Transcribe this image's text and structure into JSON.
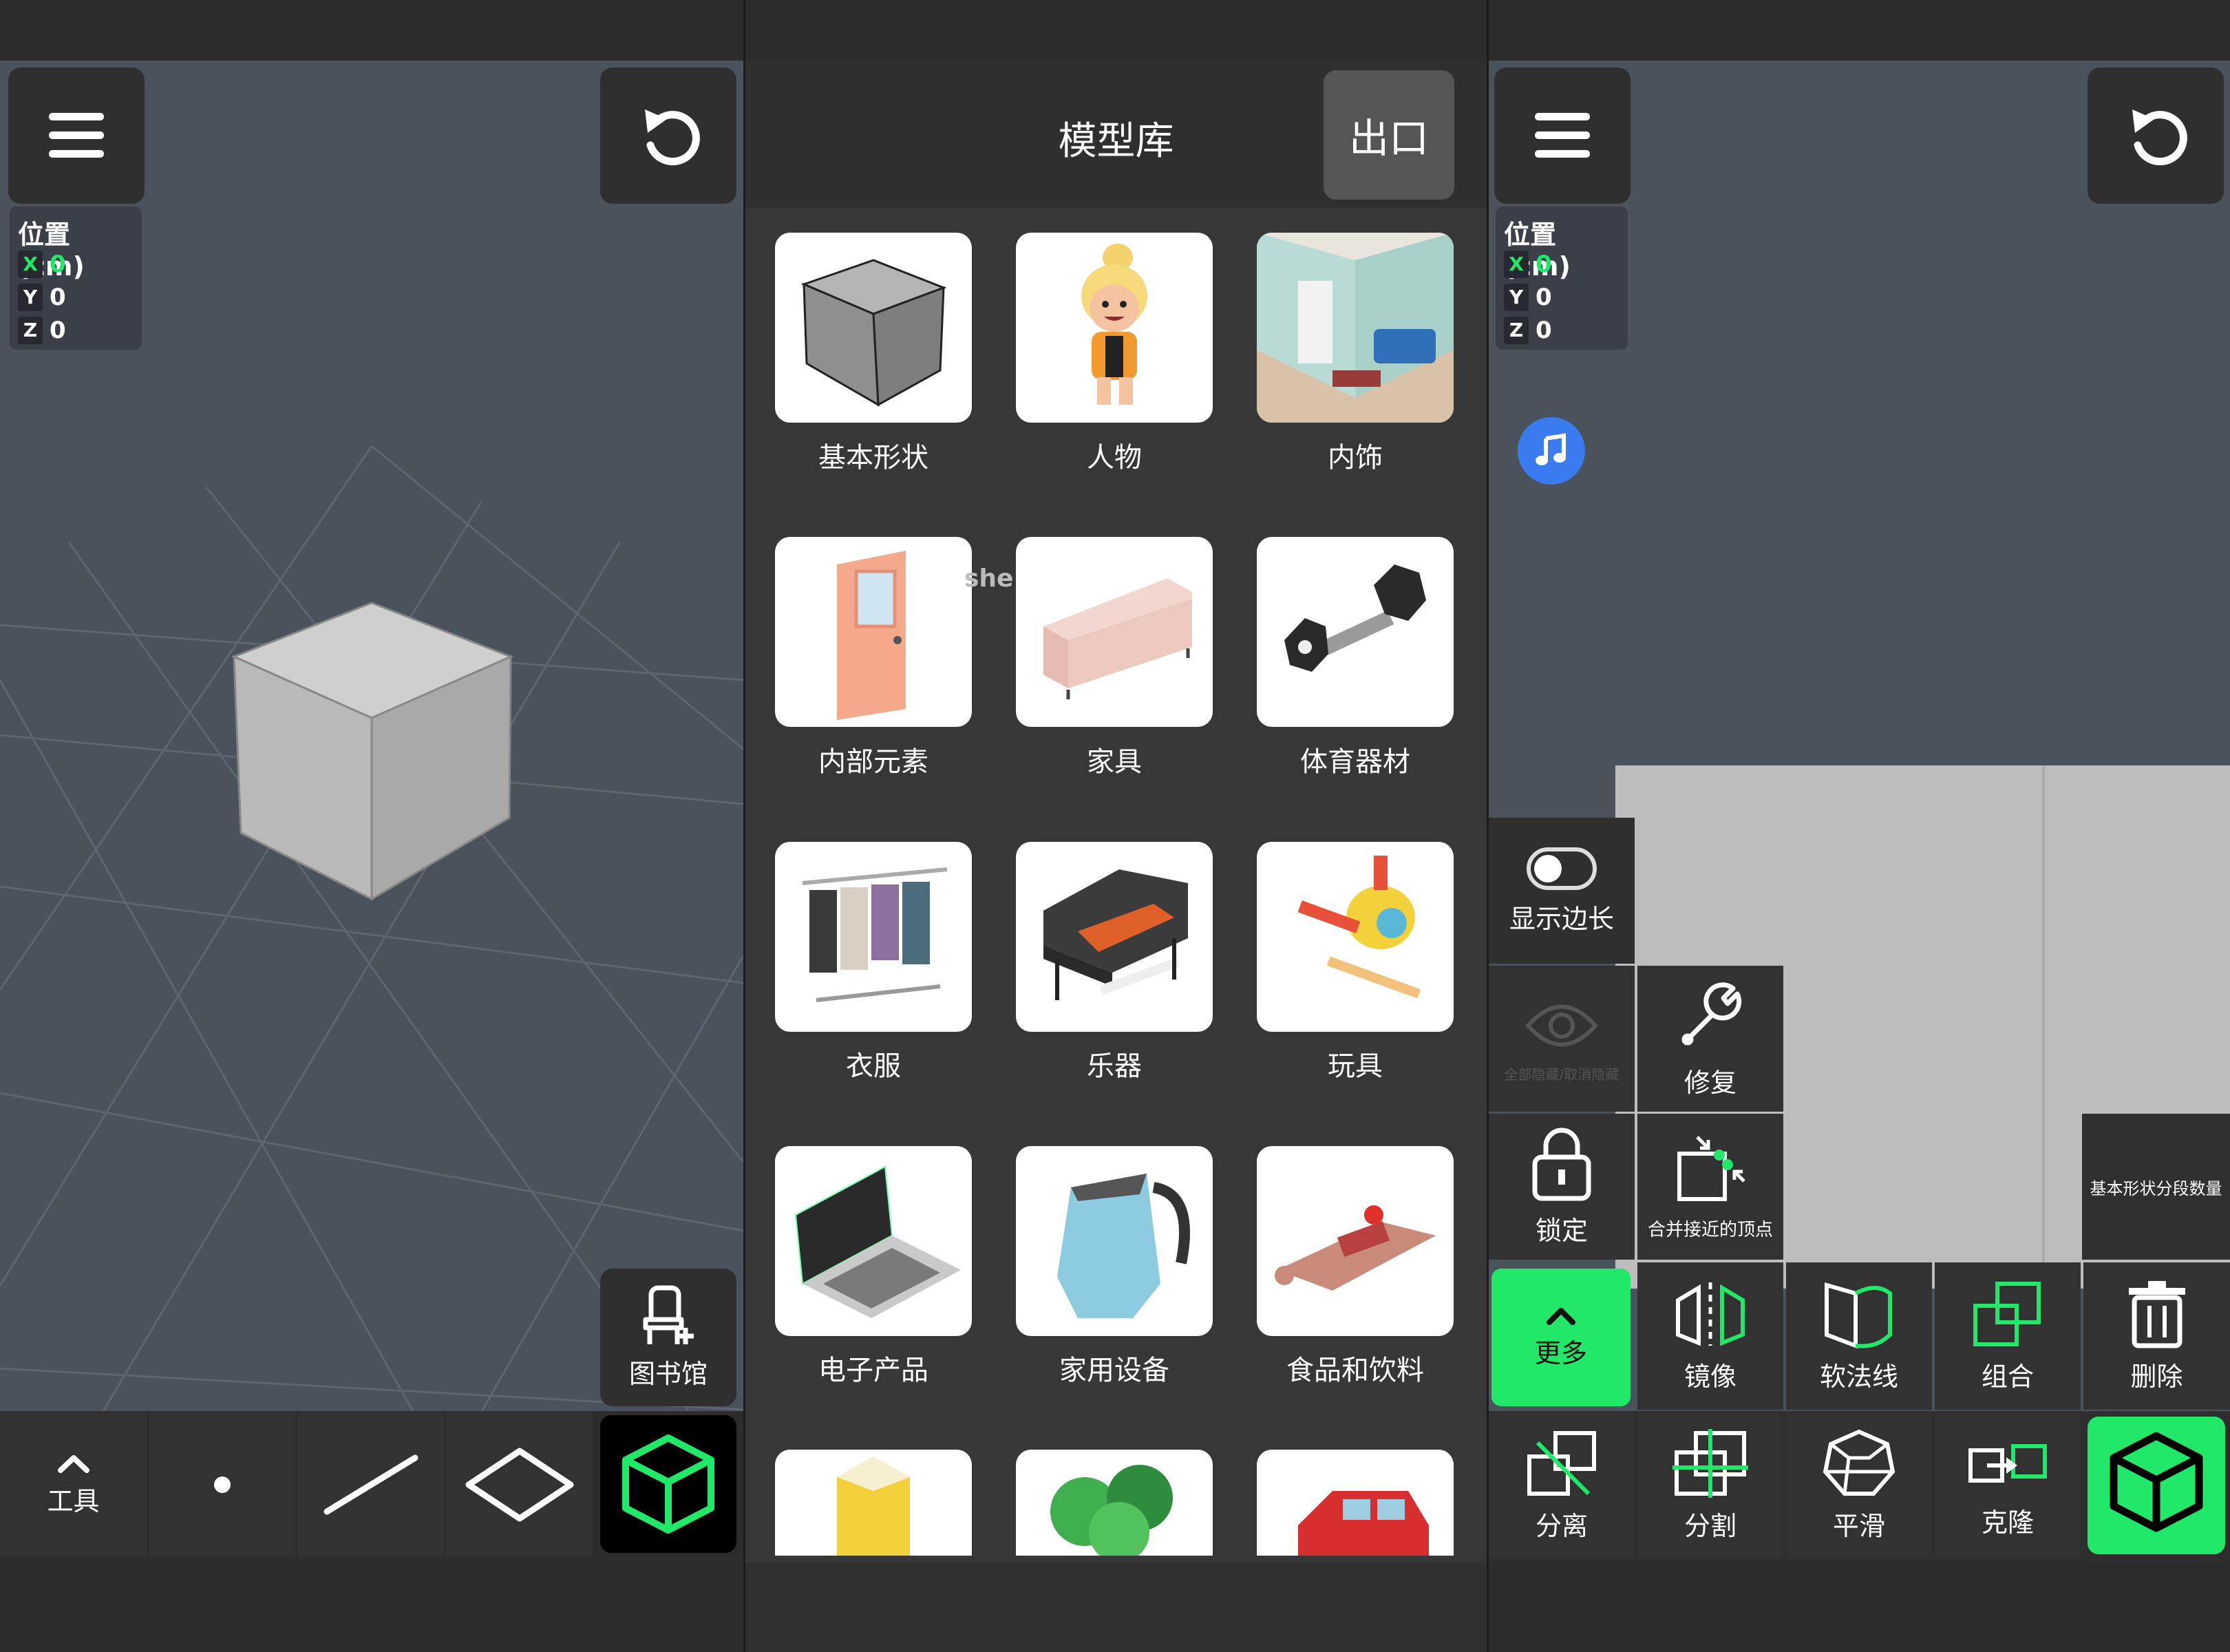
{
  "left": {
    "position": {
      "title": "位置 (cm)",
      "axes": [
        {
          "label": "X",
          "value": "0"
        },
        {
          "label": "Y",
          "value": "0"
        },
        {
          "label": "Z",
          "value": "0"
        }
      ]
    },
    "library_label": "图书馆",
    "tools_label": "工具"
  },
  "middle": {
    "title": "模型库",
    "exit_label": "出口",
    "categories": [
      "基本形状",
      "人物",
      "内饰",
      "内部元素",
      "家具",
      "体育器材",
      "衣服",
      "乐器",
      "玩具",
      "电子产品",
      "家用设备",
      "食品和饮料"
    ],
    "watermark": "she"
  },
  "right": {
    "position": {
      "title": "位置 (cm)",
      "axes": [
        {
          "label": "X",
          "value": "0"
        },
        {
          "label": "Y",
          "value": "0"
        },
        {
          "label": "Z",
          "value": "0"
        }
      ]
    },
    "show_edges": "显示边长",
    "hide_all": "全部隐藏/取消隐藏",
    "repair": "修复",
    "lock": "锁定",
    "merge_vertices": "合并接近的顶点",
    "segments": "基本形状分段数量",
    "more": "更多",
    "mirror": "镜像",
    "soft_normals": "软法线",
    "group": "组合",
    "delete": "删除",
    "separate": "分离",
    "split": "分割",
    "smooth": "平滑",
    "clone": "克隆"
  },
  "colors": {
    "accent": "#22e86a",
    "viewport": "#4a525c",
    "panel": "#2f2f2f",
    "music": "#3a7bf0",
    "x_axis": "#22e86a"
  }
}
